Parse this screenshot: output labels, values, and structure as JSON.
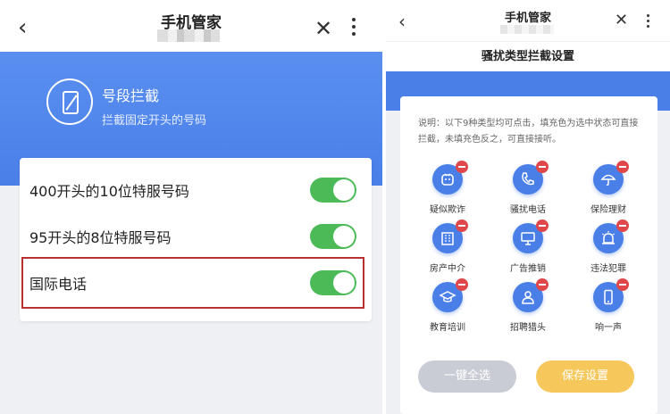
{
  "left": {
    "title": "手机管家",
    "hero": {
      "title": "号段拦截",
      "subtitle": "拦截固定开头的号码"
    },
    "rows": [
      {
        "label": "400开头的10位特服号码",
        "enabled": true
      },
      {
        "label": "95开头的8位特服号码",
        "enabled": true
      },
      {
        "label": "国际电话",
        "enabled": true
      }
    ],
    "icons": {
      "back": "chevron-left-icon",
      "close": "close-icon",
      "more": "more-vertical-icon",
      "hero": "phone-block-icon"
    },
    "colors": {
      "hero": "#4a7fe8",
      "toggle_on": "#4cbb57",
      "highlight": "#b8312f"
    }
  },
  "right": {
    "title": "手机管家",
    "subtitle": "骚扰类型拦截设置",
    "note": "说明：以下9种类型均可点击，填充色为选中状态可直接拦截，未填充色反之，可直接接听。",
    "categories": [
      {
        "label": "疑似欺诈",
        "icon": "fraud-icon"
      },
      {
        "label": "骚扰电话",
        "icon": "phone-icon"
      },
      {
        "label": "保险理财",
        "icon": "umbrella-icon"
      },
      {
        "label": "房产中介",
        "icon": "building-icon"
      },
      {
        "label": "广告推销",
        "icon": "ad-icon"
      },
      {
        "label": "违法犯罪",
        "icon": "alarm-icon"
      },
      {
        "label": "教育培训",
        "icon": "graduation-cap-icon"
      },
      {
        "label": "招聘猎头",
        "icon": "person-icon"
      },
      {
        "label": "响一声",
        "icon": "mobile-icon"
      }
    ],
    "buttons": {
      "select_all": "一键全选",
      "save": "保存设置"
    },
    "colors": {
      "accent": "#4a7fe8",
      "badge": "#e0474b",
      "save": "#f6c85c",
      "select_all": "#c9ccd4"
    }
  }
}
